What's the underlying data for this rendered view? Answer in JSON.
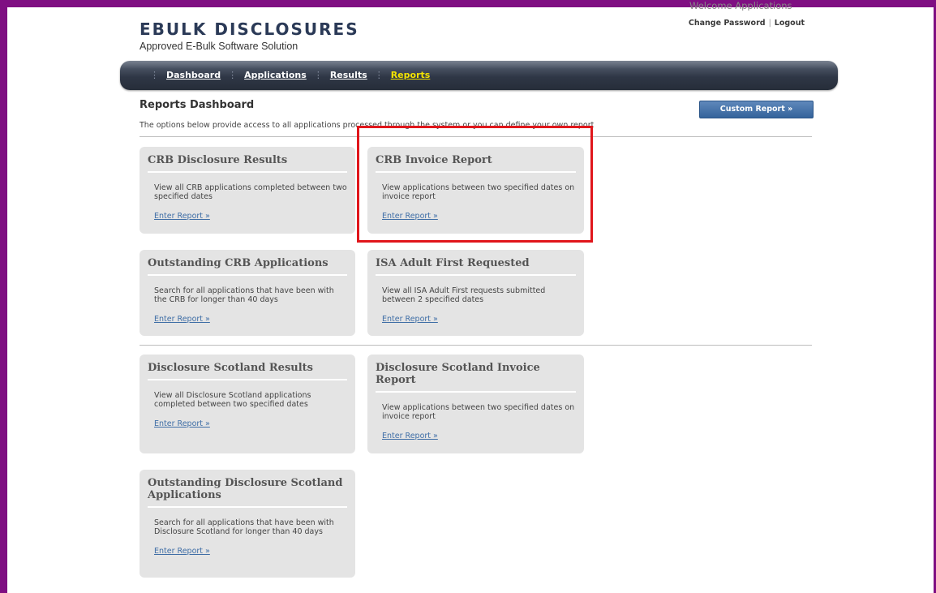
{
  "header": {
    "logo_title": "EBULK DISCLOSURES",
    "logo_subtitle": "Approved E-Bulk Software Solution",
    "welcome_text": "Welcome Applications",
    "change_password": "Change Password",
    "separator": "|",
    "logout": "Logout"
  },
  "nav": {
    "items": [
      {
        "label": "Dashboard"
      },
      {
        "label": "Applications"
      },
      {
        "label": "Results"
      },
      {
        "label": "Reports",
        "active": true
      }
    ]
  },
  "page": {
    "title": "Reports Dashboard",
    "description": "The options below provide access to all applications processed through the system or you can define your own report",
    "custom_report_button": "Custom Report »"
  },
  "cards": [
    {
      "title": "CRB Disclosure Results",
      "description": "View all CRB applications completed between two specified dates",
      "link": "Enter Report »"
    },
    {
      "title": "CRB Invoice Report",
      "description": "View applications between two specified dates on invoice report",
      "link": "Enter Report »"
    },
    {
      "title": "Outstanding CRB Applications",
      "description": "Search for all applications that have been with the CRB for longer than 40 days",
      "link": "Enter Report »"
    },
    {
      "title": "ISA Adult First Requested",
      "description": "View all ISA Adult First requests submitted between 2 specified dates",
      "link": "Enter Report »"
    },
    {
      "title": "Disclosure Scotland Results",
      "description": "View all Disclosure Scotland applications completed between two specified dates",
      "link": "Enter Report »"
    },
    {
      "title": "Disclosure Scotland Invoice Report",
      "description": "View applications between two specified dates on invoice report",
      "link": "Enter Report »"
    },
    {
      "title": "Outstanding Disclosure Scotland Applications",
      "description": "Search for all applications that have been with Disclosure Scotland for longer than 40 days",
      "link": "Enter Report »"
    }
  ],
  "colors": {
    "frame": "#7f0f82",
    "nav_active": "#f5e400",
    "highlight_box": "#e0161b",
    "link": "#3f6ea6"
  }
}
